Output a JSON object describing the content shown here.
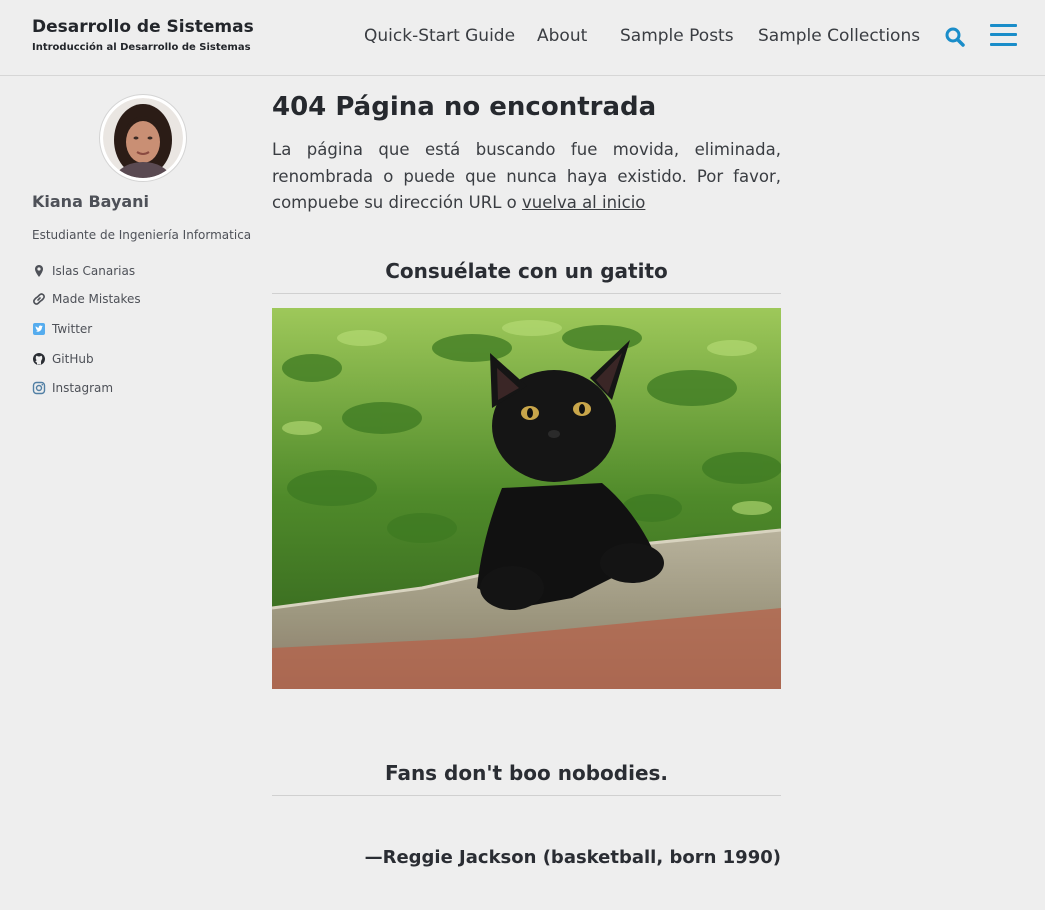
{
  "masthead": {
    "title": "Desarrollo de Sistemas",
    "subtitle": "Introducción al Desarrollo de Sistemas",
    "nav": [
      {
        "label": "Quick-Start Guide"
      },
      {
        "label": "About"
      },
      {
        "label": "Sample Posts"
      },
      {
        "label": "Sample Collections"
      }
    ],
    "search_icon": "search-icon",
    "menu_icon": "hamburger-menu-icon",
    "accent_color": "#1a8dc9"
  },
  "sidebar": {
    "author_name": "Kiana Bayani",
    "bio": "Estudiante de Ingeniería Informatica",
    "links": [
      {
        "label": "Islas Canarias",
        "icon": "map-marker-icon"
      },
      {
        "label": "Made Mistakes",
        "icon": "link-icon"
      },
      {
        "label": "Twitter",
        "icon": "twitter-icon"
      },
      {
        "label": "GitHub",
        "icon": "github-icon"
      },
      {
        "label": "Instagram",
        "icon": "instagram-icon"
      }
    ]
  },
  "main": {
    "title": "404 Página no encontrada",
    "text": "La página que está buscando fue movida, eliminada, renombrada o puede que nunca haya existido. Por favor, compuebe su dirección URL o",
    "home_link": "vuelva al inicio",
    "kitten_heading": "Consuélate con un gatito",
    "quote": "Fans don't boo nobodies.",
    "quote_author": "—Reggie Jackson (basketball, born 1990)"
  }
}
